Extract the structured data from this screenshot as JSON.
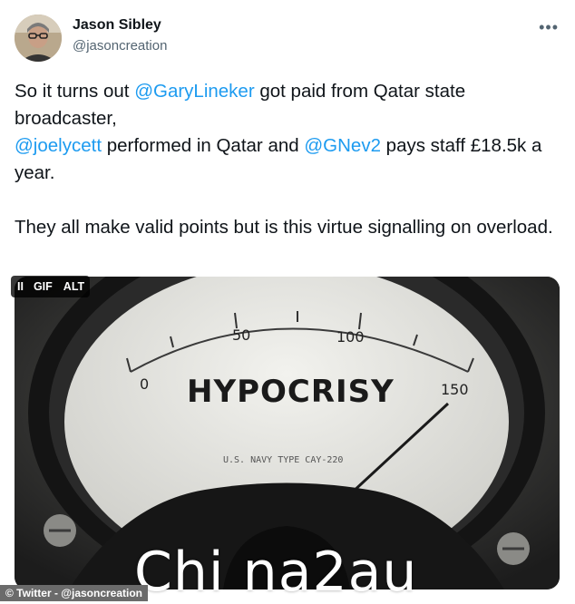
{
  "author": {
    "name": "Jason Sibley",
    "handle": "@jasoncreation"
  },
  "more_icon": "more-horizontal-icon",
  "text": {
    "p1": "So it turns out ",
    "m1": "@GaryLineker",
    "p2": " got paid from Qatar state broadcaster,\n",
    "m2": "@joelycett",
    "p3": " performed in Qatar and ",
    "m3": "@GNev2",
    "p4": " pays staff £18.5k a year.\n\nThey all make valid points but is this virtue signalling on overload."
  },
  "media": {
    "meter_title": "HYPOCRISY",
    "scale_labels": [
      "0",
      "50",
      "100",
      "150"
    ],
    "small_text": "U.S. NAVY TYPE CAY-220",
    "needle_value": 150
  },
  "controls": {
    "pause": "II",
    "gif": "GIF",
    "alt": "ALT"
  },
  "watermark": "Chi na2au",
  "credit": "© Twitter - @jasoncreation",
  "colors": {
    "mention": "#1d9bf0",
    "text": "#0f1419",
    "secondary": "#536471"
  }
}
